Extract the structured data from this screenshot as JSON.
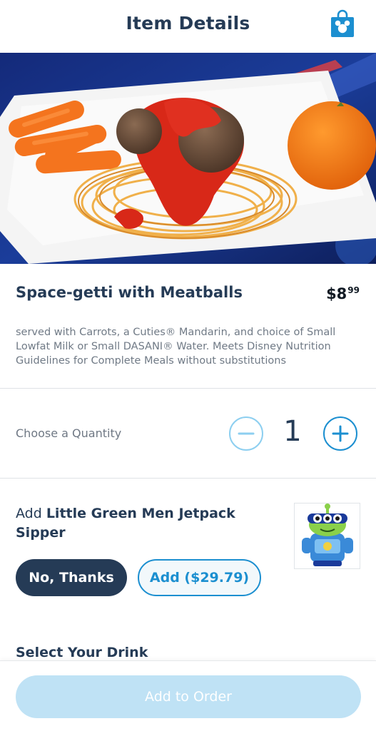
{
  "header": {
    "title": "Item Details",
    "cart_icon": "mickey-shopping-bag-icon"
  },
  "item": {
    "name": "Space-getti with Meatballs",
    "price_dollars": "$8",
    "price_cents": "99",
    "description": "served with Carrots, a Cuties® Mandarin, and choice of Small Lowfat Milk or Small DASANI® Water. Meets Disney Nutrition Guidelines for Complete Meals without substitutions"
  },
  "quantity": {
    "label": "Choose a Quantity",
    "value": "1",
    "decrement_icon": "minus-icon",
    "increment_icon": "plus-icon"
  },
  "addon": {
    "prefix": "Add ",
    "name": "Little Green Men Jetpack Sipper",
    "decline_label": "No, Thanks",
    "accept_label": "Add ($29.79)"
  },
  "drink": {
    "heading": "Select Your Drink"
  },
  "footer": {
    "order_label": "Add to Order"
  },
  "colors": {
    "primary_text": "#253b56",
    "accent_blue": "#1c8fd0",
    "light_blue": "#8dcff0",
    "disabled_button": "#bfe2f5"
  }
}
